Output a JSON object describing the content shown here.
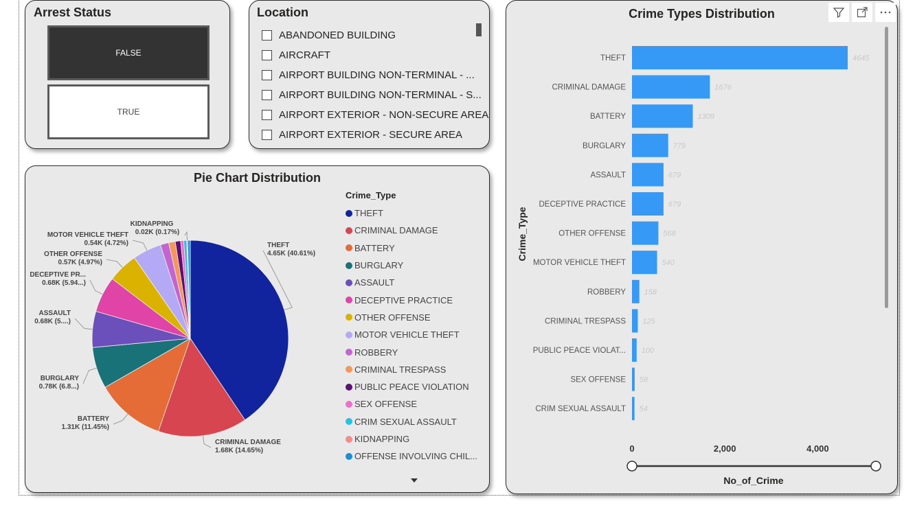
{
  "arrest": {
    "title": "Arrest Status",
    "options": [
      "FALSE",
      "TRUE"
    ],
    "selected": "FALSE"
  },
  "location": {
    "title": "Location",
    "items": [
      "ABANDONED BUILDING",
      "AIRCRAFT",
      "AIRPORT BUILDING NON-TERMINAL - ...",
      "AIRPORT BUILDING NON-TERMINAL - S...",
      "AIRPORT EXTERIOR - NON-SECURE AREA",
      "AIRPORT EXTERIOR - SECURE AREA"
    ]
  },
  "pie": {
    "title": "Pie Chart Distribution",
    "legend_title": "Crime_Type",
    "legend": [
      {
        "label": "THEFT",
        "color": "#12239e"
      },
      {
        "label": "CRIMINAL DAMAGE",
        "color": "#d64550"
      },
      {
        "label": "BATTERY",
        "color": "#e66c37"
      },
      {
        "label": "BURGLARY",
        "color": "#197278"
      },
      {
        "label": "ASSAULT",
        "color": "#6b4fbb"
      },
      {
        "label": "DECEPTIVE PRACTICE",
        "color": "#e044a7"
      },
      {
        "label": "OTHER OFFENSE",
        "color": "#d9b300"
      },
      {
        "label": "MOTOR VEHICLE THEFT",
        "color": "#b4a9f5"
      },
      {
        "label": "ROBBERY",
        "color": "#c365d1"
      },
      {
        "label": "CRIMINAL TRESPASS",
        "color": "#f5965a"
      },
      {
        "label": "PUBLIC PEACE VIOLATION",
        "color": "#5e0f73"
      },
      {
        "label": "SEX OFFENSE",
        "color": "#ee6fc9"
      },
      {
        "label": "CRIM SEXUAL ASSAULT",
        "color": "#22c3e6"
      },
      {
        "label": "KIDNAPPING",
        "color": "#fa8a8a"
      },
      {
        "label": "OFFENSE INVOLVING CHIL...",
        "color": "#1a8fd6"
      }
    ],
    "slice_values": [
      4645,
      1676,
      1309,
      779,
      679,
      679,
      568,
      540,
      158,
      125,
      100,
      58,
      54,
      20,
      48
    ],
    "callouts": [
      {
        "slice": 0,
        "name": "THEFT",
        "value": "4.65K (40.61%)"
      },
      {
        "slice": 1,
        "name": "CRIMINAL DAMAGE",
        "value": "1.68K (14.65%)"
      },
      {
        "slice": 2,
        "name": "BATTERY",
        "value": "1.31K (11.45%)"
      },
      {
        "slice": 3,
        "name": "BURGLARY",
        "value": "0.78K (6.8...)"
      },
      {
        "slice": 4,
        "name": "ASSAULT",
        "value": "0.68K (5....)"
      },
      {
        "slice": 5,
        "name": "DECEPTIVE PR...",
        "value": "0.68K (5.94...)"
      },
      {
        "slice": 6,
        "name": "OTHER OFFENSE",
        "value": "0.57K (4.97%)"
      },
      {
        "slice": 7,
        "name": "MOTOR VEHICLE THEFT",
        "value": "0.54K (4.72%)"
      },
      {
        "slice": 13,
        "name": "KIDNAPPING",
        "value": "0.02K (0.17%)"
      }
    ]
  },
  "chart_data": {
    "type": "bar",
    "title": "Crime Types Distribution",
    "xlabel": "No_of_Crime",
    "ylabel": "Crime_Type",
    "categories": [
      "THEFT",
      "CRIMINAL DAMAGE",
      "BATTERY",
      "BURGLARY",
      "ASSAULT",
      "DECEPTIVE PRACTICE",
      "OTHER OFFENSE",
      "MOTOR VEHICLE THEFT",
      "ROBBERY",
      "CRIMINAL TRESPASS",
      "PUBLIC PEACE VIOLAT...",
      "SEX OFFENSE",
      "CRIM SEXUAL ASSAULT"
    ],
    "values": [
      4645,
      1676,
      1309,
      779,
      679,
      679,
      568,
      540,
      158,
      125,
      100,
      58,
      54
    ],
    "xticks": [
      "0",
      "2,000",
      "4,000"
    ],
    "tick_values": [
      0,
      2000,
      4000
    ],
    "xlim": [
      0,
      4645
    ],
    "bar_color": "#3599f5",
    "orientation": "horizontal"
  }
}
